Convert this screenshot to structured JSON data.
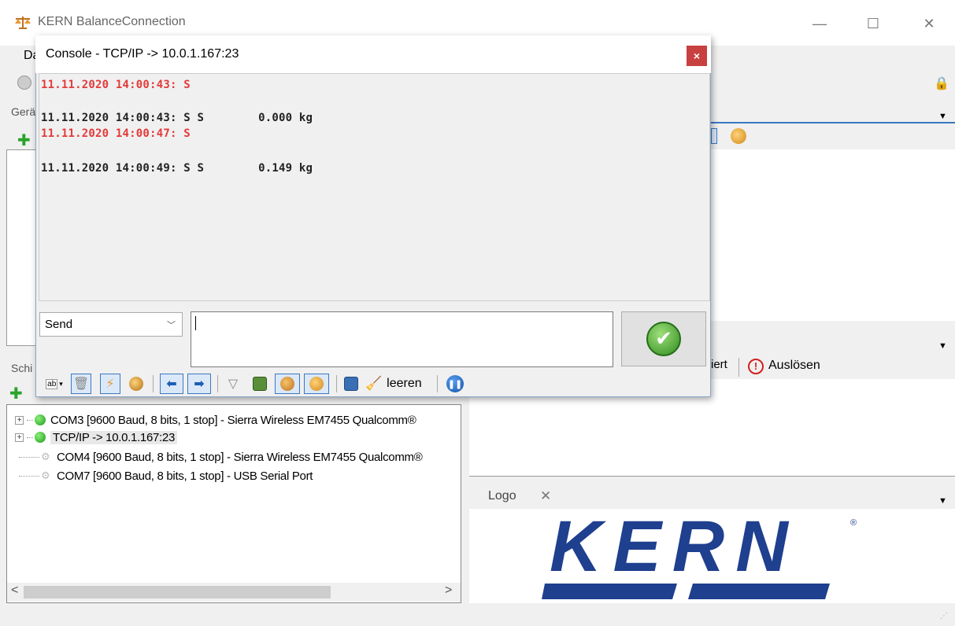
{
  "window": {
    "title": "KERN BalanceConnection",
    "controls": {
      "minimize": "—",
      "maximize": "☐",
      "close": "✕"
    },
    "menu_fragment": "Da"
  },
  "panels": {
    "geraete_label_fragment": "Gerä",
    "schnittstellen_label_fragment": "Schi",
    "ausloesen": {
      "prefix_fragment": "iert",
      "label": "Auslösen"
    },
    "logo": {
      "tab_label": "Logo",
      "close": "✕",
      "brand_text": "KERN",
      "registered": "®"
    }
  },
  "interfaces_tree": [
    {
      "label": "COM3 [9600 Baud, 8 bits, 1 stop] - Sierra Wireless EM7455 Qualcomm®",
      "status": "connected",
      "expandable": true
    },
    {
      "label": "TCP/IP -> 10.0.1.167:23",
      "status": "connected",
      "expandable": true,
      "selected": true
    },
    {
      "label": "COM4 [9600 Baud, 8 bits, 1 stop] - Sierra Wireless EM7455 Qualcomm®",
      "status": "disconnected",
      "expandable": false
    },
    {
      "label": "COM7 [9600 Baud, 8 bits, 1 stop] - USB Serial Port",
      "status": "disconnected",
      "expandable": false
    }
  ],
  "scrollbar": {
    "left": "<",
    "right": ">"
  },
  "console": {
    "title": "Console - TCP/IP -> 10.0.1.167:23",
    "close": "×",
    "log": [
      {
        "text": "11.11.2020 14:00:43: S",
        "color": "#e33a3a"
      },
      {
        "text": "11.11.2020 14:00:43: S S        0.000 kg",
        "color": "#222222"
      },
      {
        "text": "11.11.2020 14:00:47: S",
        "color": "#e33a3a"
      },
      {
        "text": "11.11.2020 14:00:49: S S        0.149 kg",
        "color": "#222222"
      }
    ],
    "send_mode": "Send",
    "send_input_value": "",
    "toolbar": {
      "leeren_label": "leeren"
    }
  },
  "colors": {
    "accent": "#3a78c4",
    "error": "#e33a3a",
    "ok": "#2e8a1e",
    "kern_blue": "#1f3f8f"
  }
}
